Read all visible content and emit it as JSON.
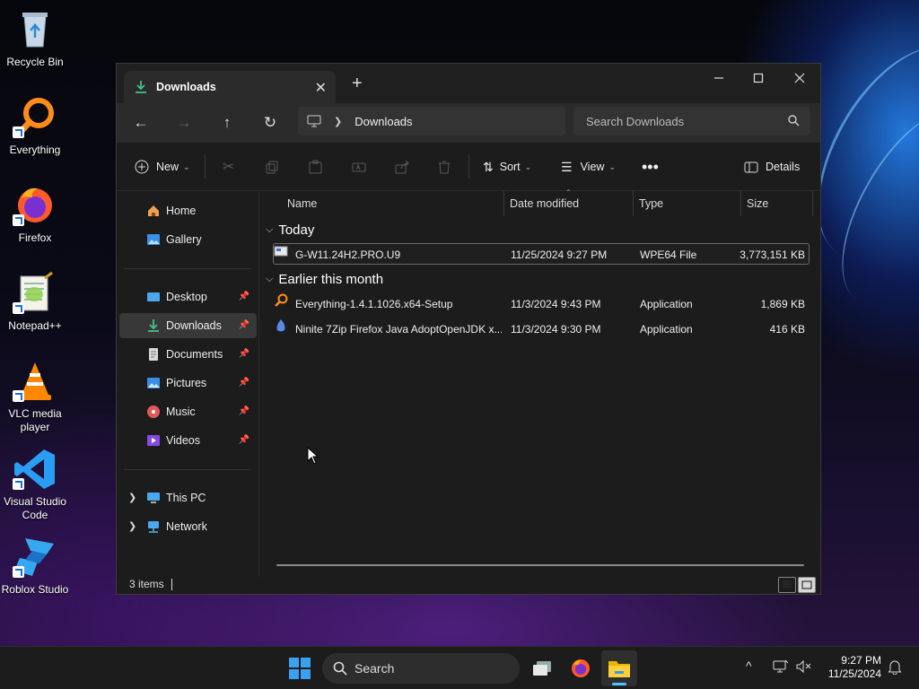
{
  "desktop": {
    "icons": [
      {
        "label": "Recycle Bin"
      },
      {
        "label": "Everything"
      },
      {
        "label": "Firefox"
      },
      {
        "label": "Notepad++"
      },
      {
        "label": "VLC media player"
      },
      {
        "label": "Visual Studio Code"
      },
      {
        "label": "Roblox Studio"
      }
    ]
  },
  "explorer": {
    "tab": {
      "label": "Downloads",
      "icon": "download-icon"
    },
    "address": {
      "path": "Downloads"
    },
    "search": {
      "placeholder": "Search Downloads"
    },
    "toolbar": {
      "new_label": "New",
      "sort_label": "Sort",
      "view_label": "View",
      "details_label": "Details"
    },
    "sidebar": {
      "items": [
        {
          "label": "Home"
        },
        {
          "label": "Gallery"
        },
        {
          "label": "Desktop"
        },
        {
          "label": "Downloads"
        },
        {
          "label": "Documents"
        },
        {
          "label": "Pictures"
        },
        {
          "label": "Music"
        },
        {
          "label": "Videos"
        },
        {
          "label": "This PC"
        },
        {
          "label": "Network"
        }
      ]
    },
    "columns": {
      "name": "Name",
      "date": "Date modified",
      "type": "Type",
      "size": "Size"
    },
    "groups": [
      {
        "title": "Today",
        "files": [
          {
            "name": "G-W11.24H2.PRO.U9",
            "date": "11/25/2024 9:27 PM",
            "type": "WPE64 File",
            "size": "3,773,151 KB"
          }
        ]
      },
      {
        "title": "Earlier this month",
        "files": [
          {
            "name": "Everything-1.4.1.1026.x64-Setup",
            "date": "11/3/2024 9:43 PM",
            "type": "Application",
            "size": "1,869 KB"
          },
          {
            "name": "Ninite 7Zip Firefox Java AdoptOpenJDK x...",
            "date": "11/3/2024 9:30 PM",
            "type": "Application",
            "size": "416 KB"
          }
        ]
      }
    ],
    "status": {
      "item_count": "3 items"
    }
  },
  "taskbar": {
    "search_label": "Search",
    "clock": {
      "time": "9:27 PM",
      "date": "11/25/2024"
    }
  },
  "colors": {
    "accent": "#4cc2ff",
    "window_bg": "#1c1c1c",
    "toolbar_bg": "#2b2b2b"
  }
}
